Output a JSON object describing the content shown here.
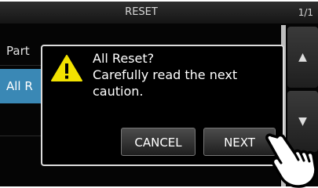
{
  "header": {
    "title": "RESET",
    "page_indicator": "1/1"
  },
  "list": {
    "items": [
      {
        "label": "Part"
      },
      {
        "label": "All R"
      },
      {
        "label": ""
      }
    ]
  },
  "side_buttons": {
    "up": "▲",
    "down": "▼"
  },
  "dialog": {
    "message_lines": [
      "All Reset?",
      "Carefully read the next",
      "caution."
    ],
    "cancel_label": "CANCEL",
    "next_label": "NEXT"
  },
  "colors": {
    "selected_item": "#3a88b5",
    "warning_yellow": "#f2e200"
  }
}
